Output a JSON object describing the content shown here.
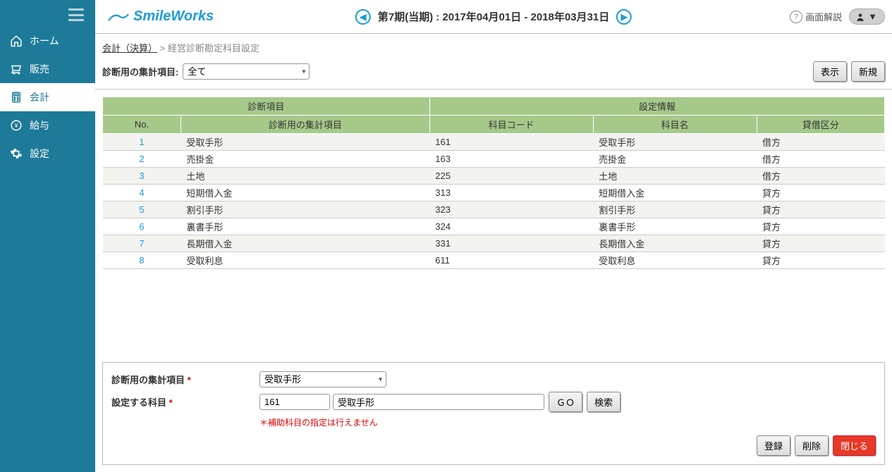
{
  "brand": "SmileWorks",
  "period": "第7期(当期) : 2017年04月01日 - 2018年03月31日",
  "help_label": "画面解説",
  "sidebar": {
    "items": [
      {
        "label": "ホーム",
        "icon": "home"
      },
      {
        "label": "販売",
        "icon": "cart"
      },
      {
        "label": "会計",
        "icon": "calc",
        "active": true
      },
      {
        "label": "給与",
        "icon": "yen"
      },
      {
        "label": "設定",
        "icon": "gear"
      }
    ]
  },
  "breadcrumb": {
    "link": "会計（決算）",
    "sep": ">",
    "current": "経営診断勘定科目設定"
  },
  "filter": {
    "label": "診断用の集計項目:",
    "value": "全て",
    "btn_show": "表示",
    "btn_new": "新規"
  },
  "table": {
    "group1": "診断項目",
    "group2": "設定情報",
    "h_no": "No.",
    "h_agg": "診断用の集計項目",
    "h_code": "科目コード",
    "h_name": "科目名",
    "h_dc": "貸借区分",
    "rows": [
      {
        "no": "1",
        "agg": "受取手形",
        "code": "161",
        "name": "受取手形",
        "dc": "借方"
      },
      {
        "no": "2",
        "agg": "売掛金",
        "code": "163",
        "name": "売掛金",
        "dc": "借方"
      },
      {
        "no": "3",
        "agg": "土地",
        "code": "225",
        "name": "土地",
        "dc": "借方"
      },
      {
        "no": "4",
        "agg": "短期借入金",
        "code": "313",
        "name": "短期借入金",
        "dc": "貸方"
      },
      {
        "no": "5",
        "agg": "割引手形",
        "code": "323",
        "name": "割引手形",
        "dc": "貸方"
      },
      {
        "no": "6",
        "agg": "裏書手形",
        "code": "324",
        "name": "裏書手形",
        "dc": "貸方"
      },
      {
        "no": "7",
        "agg": "長期借入金",
        "code": "331",
        "name": "長期借入金",
        "dc": "貸方"
      },
      {
        "no": "8",
        "agg": "受取利息",
        "code": "611",
        "name": "受取利息",
        "dc": "貸方"
      }
    ]
  },
  "form": {
    "label_agg": "診断用の集計項目",
    "value_agg": "受取手形",
    "label_item": "設定する科目",
    "code": "161",
    "name": "受取手形",
    "btn_go": "ＧＯ",
    "btn_search": "検索",
    "note": "＊補助科目の指定は行えません",
    "btn_save": "登録",
    "btn_delete": "削除",
    "btn_close": "閉じる"
  }
}
